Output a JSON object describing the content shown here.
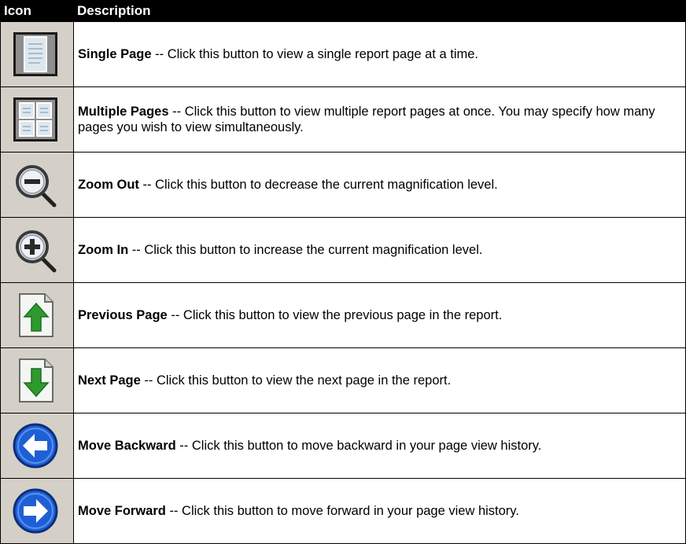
{
  "table": {
    "header": {
      "icon": "Icon",
      "description": "Description"
    },
    "rows": [
      {
        "icon": "single-page-icon",
        "name": "Single Page",
        "sep": " -- ",
        "text": "Click this button to view a single report page at a time."
      },
      {
        "icon": "multiple-pages-icon",
        "name": "Multiple Pages",
        "sep": " -- ",
        "text": "Click this button to view multiple report pages at once. You may specify how many pages you wish to view simultaneously."
      },
      {
        "icon": "zoom-out-icon",
        "name": "Zoom Out",
        "sep": " -- ",
        "text": "Click this button to decrease the current magnification level."
      },
      {
        "icon": "zoom-in-icon",
        "name": "Zoom In",
        "sep": " -- ",
        "text": "Click this button to increase the current magnification level."
      },
      {
        "icon": "previous-page-icon",
        "name": "Previous Page",
        "sep": " -- ",
        "text": "Click this button to view the previous page in the report."
      },
      {
        "icon": "next-page-icon",
        "name": "Next Page",
        "sep": " -- ",
        "text": "Click this button to view the next page in the report."
      },
      {
        "icon": "move-backward-icon",
        "name": "Move Backward",
        "sep": " -- ",
        "text": "Click this button to move backward in your page view history."
      },
      {
        "icon": "move-forward-icon",
        "name": "Move Forward",
        "sep": " -- ",
        "text": "Click this button to move forward in your page view history."
      }
    ]
  },
  "colors": {
    "header_bg": "#000000",
    "icon_cell_bg": "#d4d0c8",
    "arrow_green": "#2e9a2e",
    "arrow_blue": "#1f5fd6"
  }
}
